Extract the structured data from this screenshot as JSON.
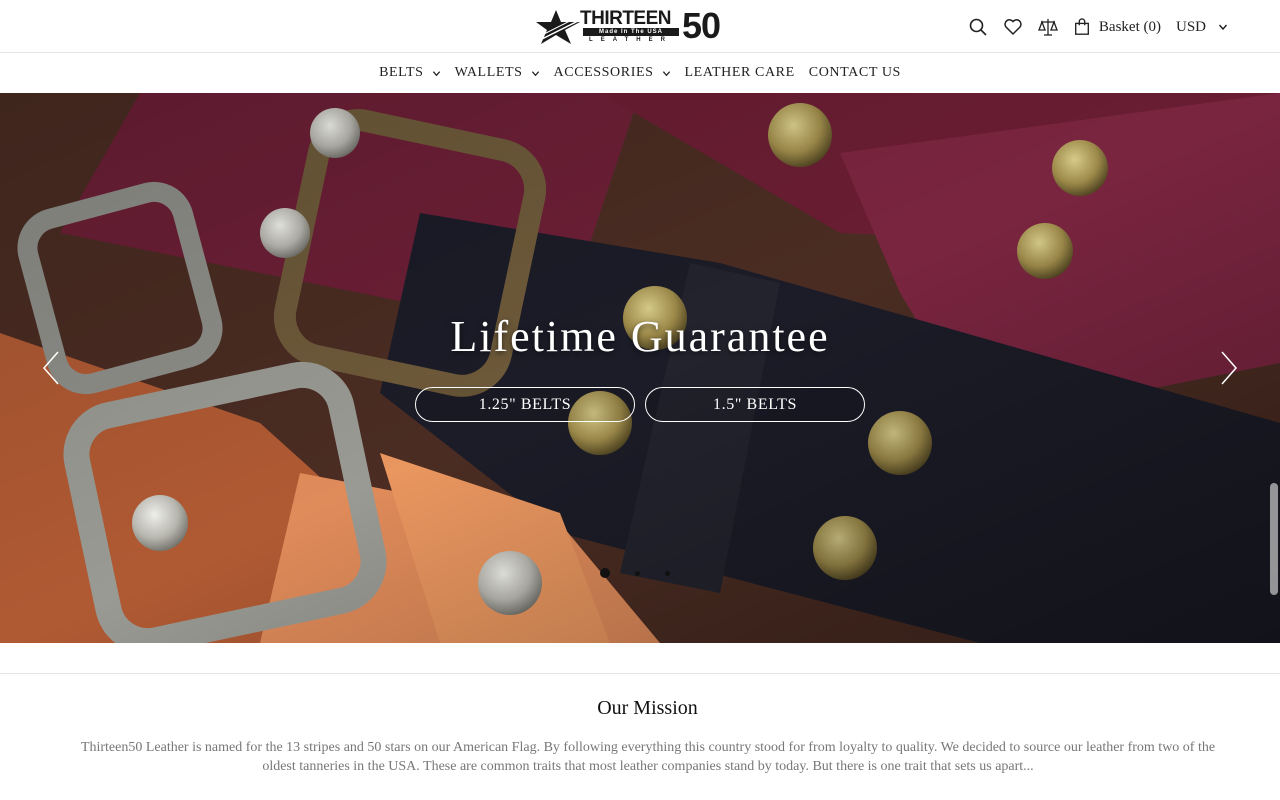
{
  "brand": {
    "logo_text_main": "THIRTEEN",
    "logo_text_number": "50",
    "logo_tagline": "Made In The USA",
    "logo_sub": "LEATHER"
  },
  "header": {
    "icons": [
      "search-icon",
      "heart-icon",
      "compare-icon",
      "basket-icon"
    ],
    "basket_label": "Basket (0)",
    "currency": "USD"
  },
  "nav": {
    "items": [
      {
        "label": "BELTS",
        "has_dropdown": true
      },
      {
        "label": "WALLETS",
        "has_dropdown": true
      },
      {
        "label": "ACCESSORIES",
        "has_dropdown": true
      },
      {
        "label": "LEATHER CARE",
        "has_dropdown": false
      },
      {
        "label": "CONTACT US",
        "has_dropdown": false
      }
    ]
  },
  "hero": {
    "title": "Lifetime Guarantee",
    "buttons": [
      "1.25\" BELTS",
      "1.5\" BELTS"
    ],
    "slide_count": 3,
    "active_slide": 1
  },
  "mission": {
    "title": "Our Mission",
    "text": "Thirteen50 Leather is named for the 13 stripes and 50 stars on our American Flag. By following everything this country stood for from loyalty to quality. We decided to source our leather from two of the oldest tanneries in the USA. These are common traits that most leather companies stand by today. But there is one trait that sets us apart..."
  },
  "colors": {
    "text": "#222222",
    "muted": "#777777",
    "border": "#e5e5e5"
  }
}
